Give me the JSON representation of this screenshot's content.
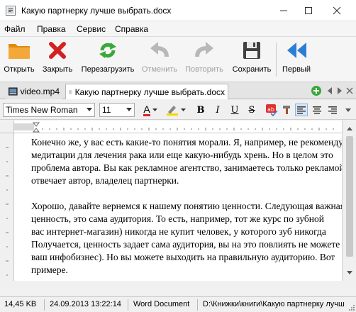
{
  "window": {
    "title": "Какую партнерку лучше выбрать.docx"
  },
  "menu": {
    "items": [
      "Файл",
      "Правка",
      "Сервис",
      "Справка"
    ]
  },
  "toolbar": {
    "open_label": "Открыть",
    "close_label": "Закрыть",
    "reload_label": "Перезагрузить",
    "undo_label": "Отменить",
    "redo_label": "Повторить",
    "save_label": "Сохранить",
    "first_label": "Первый",
    "undo_enabled": false,
    "redo_enabled": false
  },
  "tabs": {
    "items": [
      {
        "label": "video.mp4",
        "icon": "video-file-icon",
        "active": false
      },
      {
        "label": "Какую партнерку лучше выбрать.docx",
        "icon": "document-file-icon",
        "active": true
      }
    ]
  },
  "format": {
    "font_family": "Times New Roman",
    "font_size": "11",
    "bold": "B",
    "italic": "I",
    "underline": "U",
    "strike": "S",
    "font_color_letter": "A",
    "accent_red": "#e02020",
    "highlight_color": "#f5d800"
  },
  "document": {
    "lines": [
      "Конечно же, у вас есть какие-то понятия морали. Я, например, не рекомендую",
      "медитации для лечения рака или еще какую-нибудь хрень. Но в целом это",
      "проблема автора. Вы как рекламное агентство, занимаетесь только рекламой,",
      "отвечает автор, владелец партнерки.",
      "",
      "Хорошо, давайте вернемся к нашему понятию ценности. Следующая важная",
      "ценность, это сама аудитория. То есть, например, тот же курс по зубной",
      "вас интернет-магазин) никогда не купит человек, у которого зуб никогда",
      "Получается, ценность задает сама аудитория, вы на это повлиять не можете",
      "ваш инфобизнес). Но вы можете выходить на правильную аудиторию. Вот",
      "примере."
    ]
  },
  "status": {
    "size": "14,45 KB",
    "datetime": "24.09.2013 13:22:14",
    "doc_type": "Word Document",
    "path": "D:\\Книжки\\книги\\Какую партнерку лучше выбрать.docx"
  },
  "colors": {
    "folder_orange": "#f0a030",
    "close_red": "#d42020",
    "reload_green": "#3aa83a",
    "arrow_blue": "#2a7fd4",
    "disabled_gray": "#b8b8b8",
    "save_dark": "#404040"
  }
}
